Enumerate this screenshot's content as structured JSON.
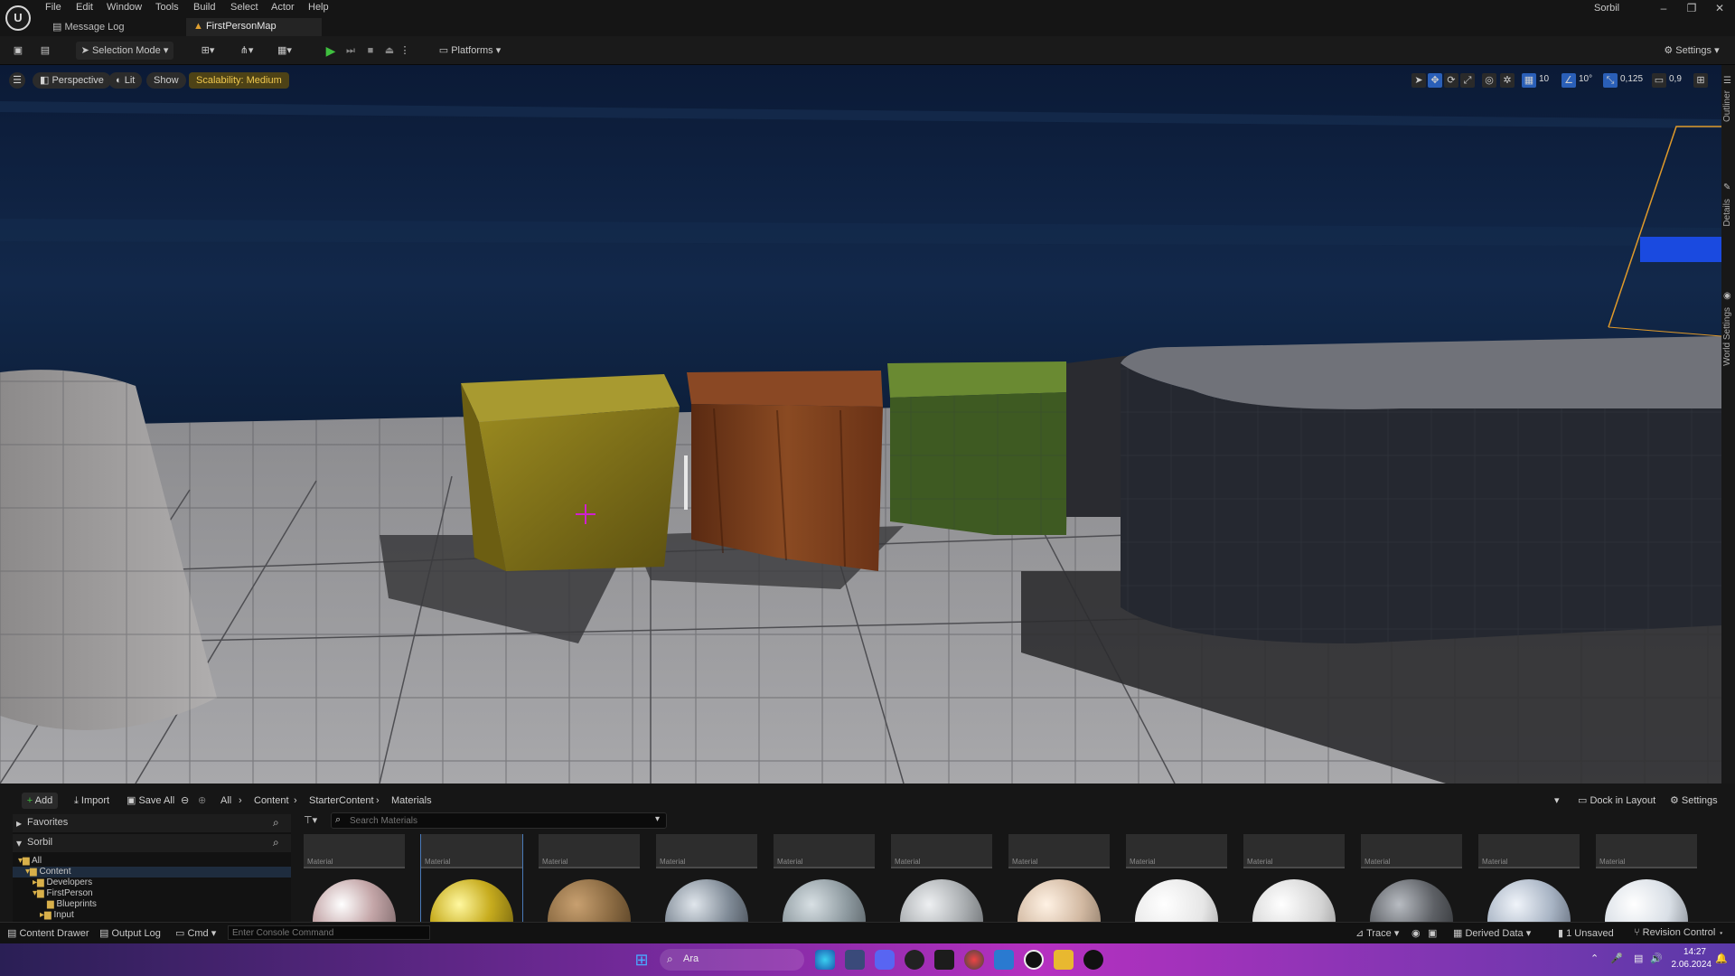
{
  "app": {
    "user": "Sorbil"
  },
  "menu": [
    "File",
    "Edit",
    "Window",
    "Tools",
    "Build",
    "Select",
    "Actor",
    "Help"
  ],
  "tabs": [
    {
      "label": "Message Log"
    },
    {
      "label": "FirstPersonMap"
    }
  ],
  "toolbar": {
    "mode": "Selection Mode",
    "platforms": "Platforms",
    "settings": "Settings"
  },
  "viewport": {
    "perspective": "Perspective",
    "lit": "Lit",
    "show": "Show",
    "scalability": "Scalability: Medium",
    "grid_snap": "10",
    "rot_snap": "10°",
    "scale_snap": "0,125",
    "cam_speed": "0,9"
  },
  "sidepanel": {
    "outliner": "Outliner",
    "details": "Details",
    "world": "World Settings"
  },
  "content_browser": {
    "add": "Add",
    "import": "Import",
    "save_all": "Save All",
    "path": [
      "All",
      "Content",
      "StarterContent",
      "Materials"
    ],
    "dock": "Dock in Layout",
    "settings": "Settings",
    "favorites": "Favorites",
    "user_root": "Sorbil",
    "search_placeholder": "Search Materials",
    "tree": [
      "All",
      "Content",
      "Developers",
      "FirstPerson",
      "Blueprints",
      "Input"
    ],
    "asset_type": "Material",
    "asset_colors": [
      "#c4a6a8",
      "#c7ac1e",
      "#8a6a42",
      "#7f8a96",
      "#8e9aa0",
      "#a9adb0",
      "#d2b9a2",
      "#e6e6e6",
      "#d4d4d4",
      "#5d6065",
      "#a8b4c4",
      "#d9dfe6"
    ]
  },
  "statusbar": {
    "content_drawer": "Content Drawer",
    "output_log": "Output Log",
    "cmd": "Cmd",
    "console_placeholder": "Enter Console Command",
    "trace": "Trace",
    "derived": "Derived Data",
    "unsaved": "1 Unsaved",
    "revision": "Revision Control"
  },
  "taskbar": {
    "search": "Ara",
    "time": "14:27",
    "date": "2.06.2024"
  }
}
